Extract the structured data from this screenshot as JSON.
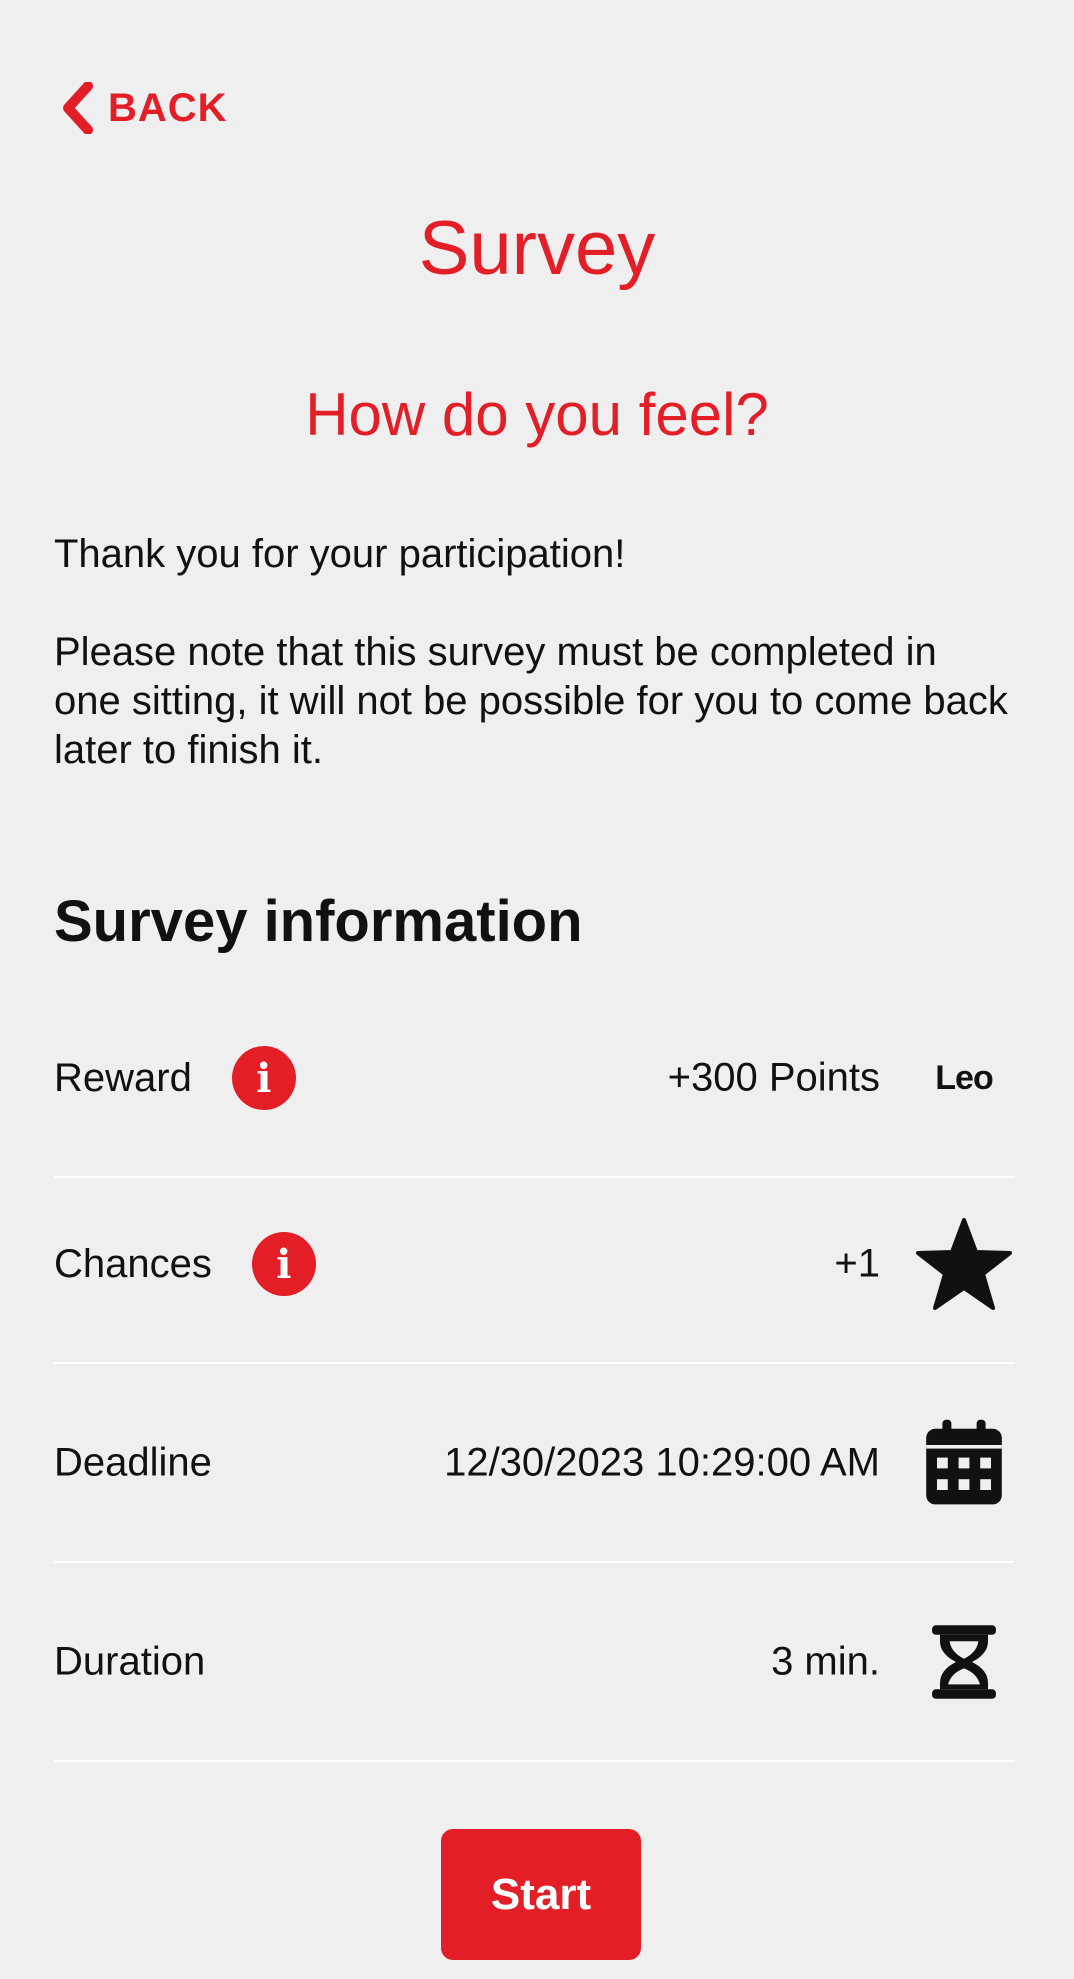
{
  "header": {
    "back_label": "BACK",
    "title": "Survey",
    "subtitle": "How do you feel?"
  },
  "intro": {
    "thanks": "Thank you for your participation!",
    "note": "Please note that this survey must be completed in one sitting, it will not be possible for you to come back later to finish it."
  },
  "info": {
    "heading": "Survey information",
    "rows": [
      {
        "label": "Reward",
        "value": "+300 Points",
        "icon": "leo-logo",
        "has_info": true,
        "logo_text": "Leo"
      },
      {
        "label": "Chances",
        "value": "+1",
        "icon": "star-icon",
        "has_info": true
      },
      {
        "label": "Deadline",
        "value": "12/30/2023 10:29:00 AM",
        "icon": "calendar-icon",
        "has_info": false
      },
      {
        "label": "Duration",
        "value": "3 min.",
        "icon": "hourglass-icon",
        "has_info": false
      }
    ]
  },
  "actions": {
    "start_label": "Start"
  },
  "colors": {
    "accent": "#e31e26",
    "background": "#efefef",
    "text": "#111111"
  }
}
